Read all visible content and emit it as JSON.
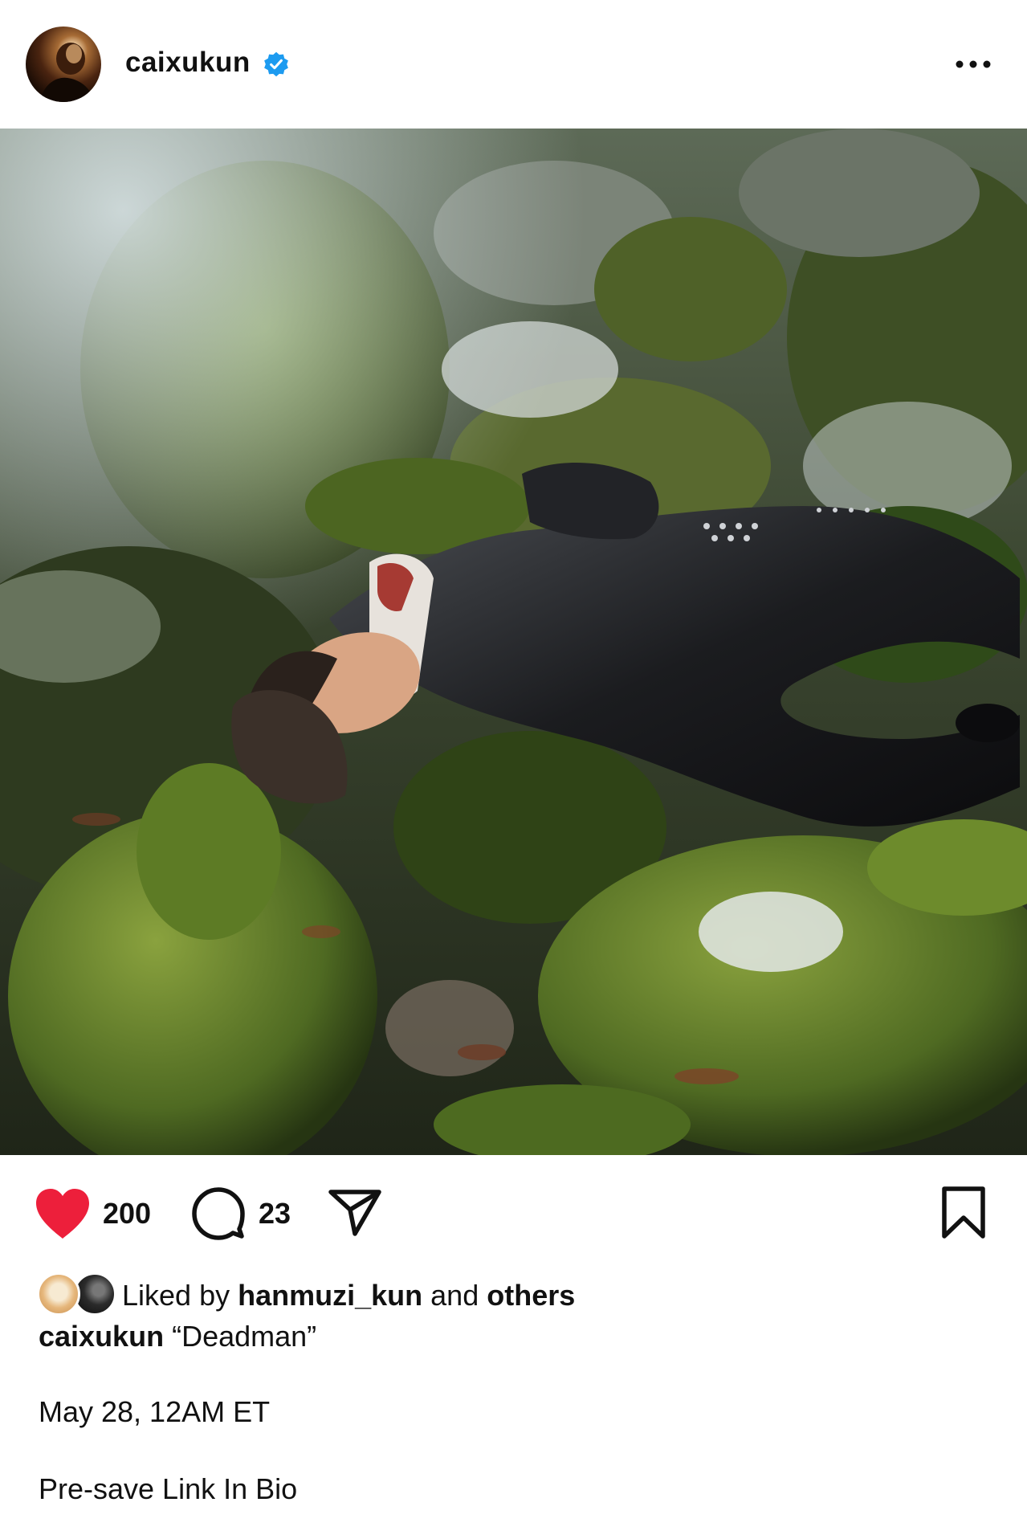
{
  "post": {
    "username": "caixukun",
    "verified": true,
    "more_icon": "more-horizontal-icon"
  },
  "image": {
    "description_icon": "post-photo"
  },
  "actions": {
    "like_count": "200",
    "comment_count": "23",
    "liked": true,
    "accent": "#ed1f3b"
  },
  "likes": {
    "prefix": "Liked by",
    "user": "hanmuzi_kun",
    "and": "and",
    "others": "others"
  },
  "caption": {
    "username": "caixukun",
    "text": "“Deadman”",
    "line2": "May 28, 12AM ET",
    "line3": "Pre-save Link In Bio"
  },
  "colors": {
    "verified_blue": "#1d9bf0",
    "text": "#111111"
  }
}
